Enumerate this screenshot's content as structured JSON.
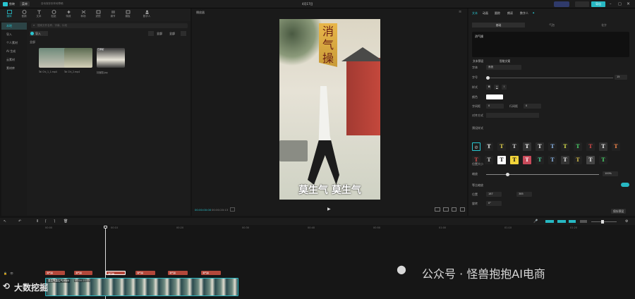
{
  "app": {
    "title": "剪映",
    "menu": "菜单",
    "autosave": "自动保存到本地草稿",
    "project": "4月17日",
    "export": "导出"
  },
  "toolbar": [
    {
      "label": "媒体",
      "active": true
    },
    {
      "label": "音频"
    },
    {
      "label": "文本"
    },
    {
      "label": "贴纸"
    },
    {
      "label": "特效"
    },
    {
      "label": "转场"
    },
    {
      "label": "滤镜"
    },
    {
      "label": "调节"
    },
    {
      "label": "模板"
    },
    {
      "label": "数字人"
    }
  ],
  "leftnav": [
    {
      "label": "本地",
      "active": true
    },
    {
      "label": "导入"
    },
    {
      "label": "个人素材"
    },
    {
      "label": "AI 生成"
    },
    {
      "label": "云素材"
    },
    {
      "label": "素材库"
    }
  ],
  "media": {
    "search_placeholder": "搜索文件名称、字幕、片段",
    "import": "导入",
    "sort": "全部",
    "section": "全部",
    "files": [
      {
        "name": "Tai Chi_1_1.mp4",
        "badge": ""
      },
      {
        "name": "Tai Chi_2.mp4",
        "badge": ""
      },
      {
        "name": "封面图.jpg",
        "badge": "已添加"
      }
    ]
  },
  "player": {
    "title": "播放器",
    "time_current": "00:00:00:00",
    "time_total": "00:00:20:13",
    "poster_title": "消气操",
    "poster_caption": "莫生气 莫生气"
  },
  "props": {
    "tabs": [
      "文本",
      "动画",
      "跟踪",
      "朗读",
      "数字人"
    ],
    "subtabs": [
      "基础",
      "气泡",
      "花字"
    ],
    "text_value": "消气操",
    "preset_label": "文本预设",
    "smart_label": "智能文案",
    "font_label": "字体",
    "font_value": "系统",
    "size_label": "字号",
    "size_value": "15",
    "style_label": "样式",
    "color_label": "颜色",
    "spacing_label": "字间距",
    "spacing_value": "0",
    "line_label": "行间距",
    "line_value": "0",
    "align_label": "对齐方式",
    "preset_style_label": "预设样式",
    "opacity_label": "不透明度",
    "opacity_value": "100%",
    "layout_label": "位置大小",
    "scale_label": "缩放",
    "scale_value": "100%",
    "uniform_label": "等比缩放",
    "pos_label": "位置",
    "pos_x": "187",
    "pos_y": "385",
    "rot_label": "旋转",
    "rot_value": "0°",
    "save_preset": "保存预设"
  },
  "timeline": {
    "clips": [
      "消气操",
      "消气操",
      "消气操",
      "消气操",
      "消气操",
      "消气操"
    ],
    "main_clip": "莫生气莫生气.mp4",
    "main_clip_time": "00:00:20:13",
    "ticks": [
      "00:00",
      "00:10",
      "00:20",
      "00:30",
      "00:40",
      "00:50",
      "01:00",
      "01:10",
      "01:20"
    ]
  },
  "watermark": {
    "left": "大数挖掘",
    "right": "公众号 · 怪兽抱抱AI电商"
  }
}
